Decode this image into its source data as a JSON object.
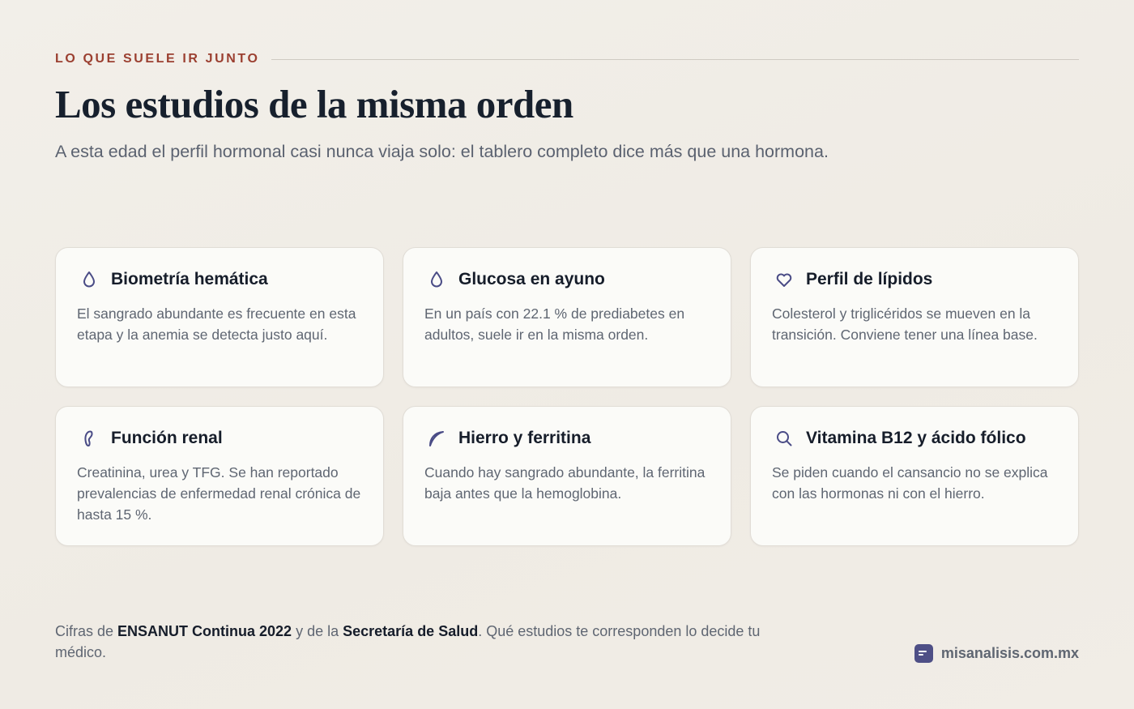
{
  "header": {
    "eyebrow": "LO QUE SUELE IR JUNTO",
    "title": "Los estudios de la misma orden",
    "subtitle": "A esta edad el perfil hormonal casi nunca viaja solo: el tablero completo dice más que una hormona."
  },
  "cards": [
    {
      "icon": "drop-icon",
      "title": "Biometría hemática",
      "text": "El sangrado abundante es frecuente en esta etapa y la anemia se detecta justo aquí."
    },
    {
      "icon": "drop-icon",
      "title": "Glucosa en ayuno",
      "text": "En un país con 22.1 % de prediabetes en adultos, suele ir en la misma orden."
    },
    {
      "icon": "heart-icon",
      "title": "Perfil de lípidos",
      "text": "Colesterol y triglicéridos se mueven en la transición. Conviene tener una línea base."
    },
    {
      "icon": "kidney-icon",
      "title": "Función renal",
      "text": "Creatinina, urea y TFG. Se han reportado prevalencias de enfermedad renal crónica de hasta 15 %."
    },
    {
      "icon": "leaf-icon",
      "title": "Hierro y ferritina",
      "text": "Cuando hay sangrado abundante, la ferritina baja antes que la hemoglobina."
    },
    {
      "icon": "search-icon",
      "title": "Vitamina B12 y ácido fólico",
      "text": "Se piden cuando el cansancio no se explica con las hormonas ni con el hierro."
    }
  ],
  "footnote": {
    "part1": "Cifras de ",
    "source1": "ENSANUT Continua 2022",
    "part2": " y de la ",
    "source2": "Secretaría de Salud",
    "part3": ". Qué estudios te corresponden lo decide tu médico."
  },
  "brand": {
    "icon": "brand-logo-icon",
    "name": "misanalisis.com.mx"
  },
  "colors": {
    "accent": "#9b3f30",
    "icon": "#4a4c86",
    "title": "#17202d",
    "body": "#5f6672"
  }
}
